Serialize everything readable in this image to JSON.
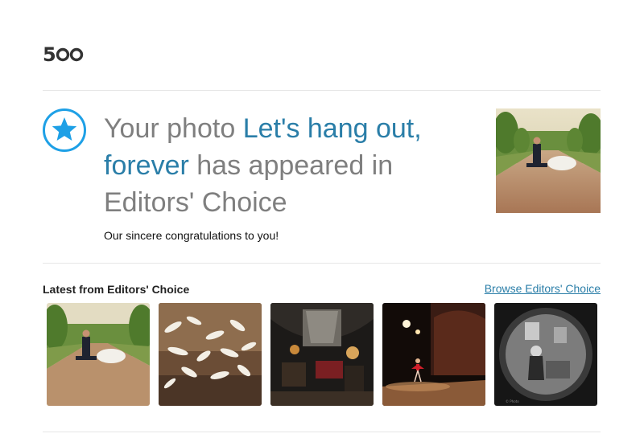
{
  "brand": {
    "logo_text": "500",
    "logo_color": "#333333"
  },
  "notification": {
    "icon": "star-icon",
    "icon_color": "#1ea0e6",
    "prefix": "Your photo ",
    "photo_title": "Let's hang out, forever",
    "suffix": " has appeared in Editors' Choice",
    "link_color": "#2a7ea8",
    "congrats": "Our sincere congratulations to you!"
  },
  "latest": {
    "title": "Latest from Editors' Choice",
    "browse_label": "Browse Editors' Choice",
    "photos": [
      {
        "subject": "couple-on-road"
      },
      {
        "subject": "white-birds"
      },
      {
        "subject": "dark-room-interior"
      },
      {
        "subject": "ballerina-on-stage"
      },
      {
        "subject": "mirror-portrait-bw"
      }
    ]
  }
}
